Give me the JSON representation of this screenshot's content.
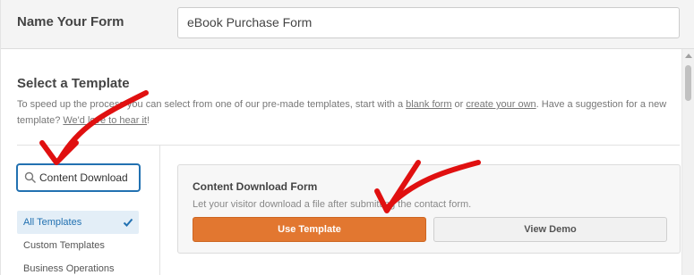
{
  "form_name": {
    "label": "Name Your Form",
    "value": "eBook Purchase Form"
  },
  "template_section": {
    "title": "Select a Template",
    "desc_part1": "To speed up the process you can select from one of our pre-made templates, start with a ",
    "blank_form_link": "blank form",
    "desc_part2": " or ",
    "create_own_link": "create your own",
    "desc_part3": ". Have a suggestion for a new template? ",
    "hear_it_link": "We'd love to hear it",
    "desc_part4": "!"
  },
  "search": {
    "value": "Content Download"
  },
  "categories": [
    {
      "label": "All Templates",
      "active": true
    },
    {
      "label": "Custom Templates",
      "active": false
    },
    {
      "label": "Business Operations",
      "active": false
    }
  ],
  "template_card": {
    "title": "Content Download Form",
    "description": "Let your visitor download a file after submitting the contact form.",
    "use_button": "Use Template",
    "demo_button": "View Demo"
  },
  "colors": {
    "accent_orange": "#e27730",
    "arrow_red": "#e01010",
    "link_blue": "#2271b1"
  }
}
